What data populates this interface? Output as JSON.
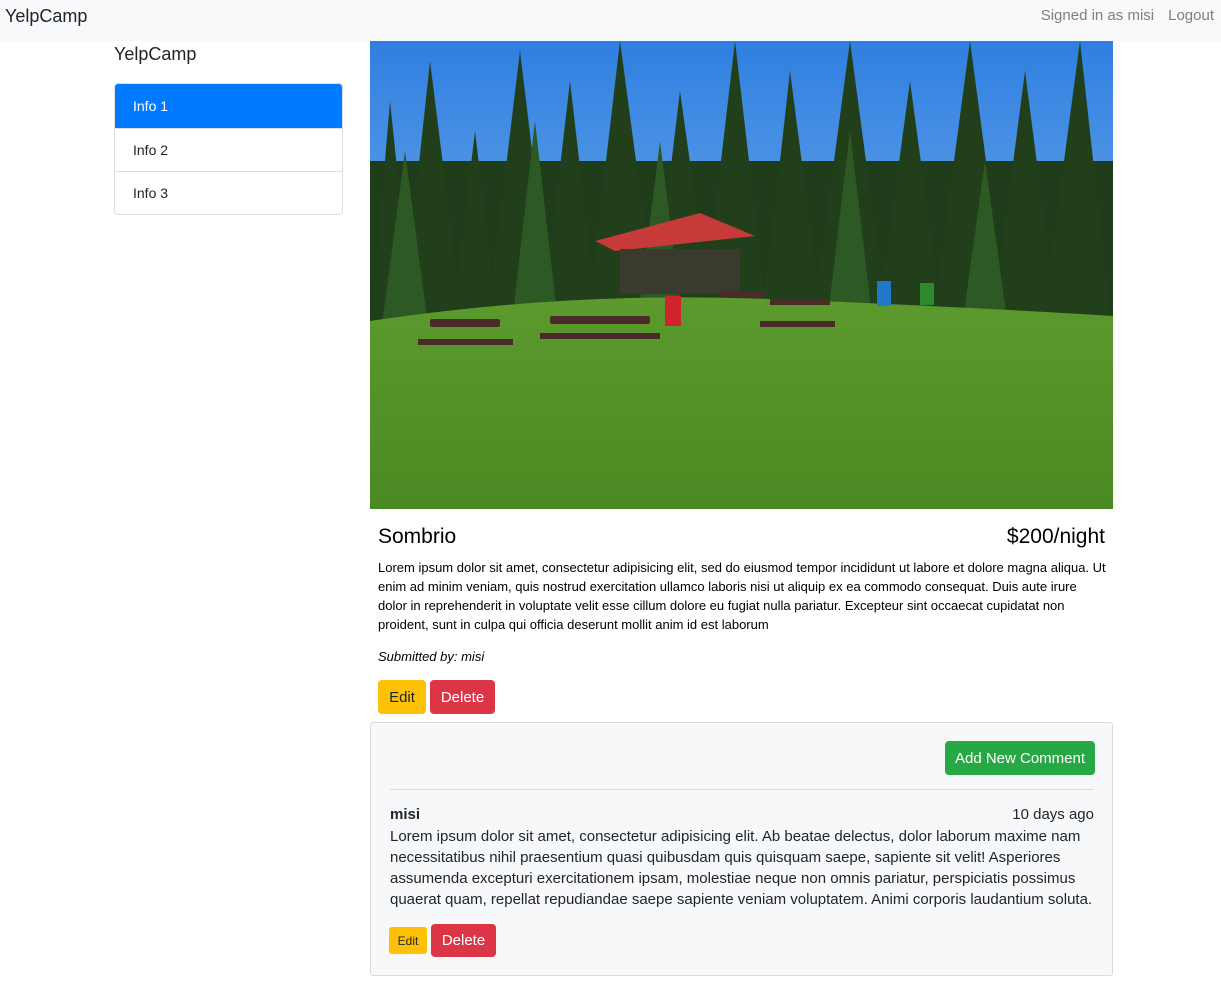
{
  "navbar": {
    "brand": "YelpCamp",
    "signed_in": "Signed in as misi",
    "logout": "Logout"
  },
  "sidebar": {
    "title": "YelpCamp",
    "items": [
      {
        "label": "Info 1",
        "active": true
      },
      {
        "label": "Info 2",
        "active": false
      },
      {
        "label": "Info 3",
        "active": false
      }
    ]
  },
  "campground": {
    "name": "Sombrio",
    "price": "$200/night",
    "description": "Lorem ipsum dolor sit amet, consectetur adipisicing elit, sed do eiusmod tempor incididunt ut labore et dolore magna aliqua. Ut enim ad minim veniam, quis nostrud exercitation ullamco laboris nisi ut aliquip ex ea commodo consequat. Duis aute irure dolor in reprehenderit in voluptate velit esse cillum dolore eu fugiat nulla pariatur. Excepteur sint occaecat cupidatat non proident, sunt in culpa qui officia deserunt mollit anim id est laborum",
    "submitted_by": "Submitted by: misi",
    "edit_label": "Edit",
    "delete_label": "Delete"
  },
  "comments": {
    "add_label": "Add New Comment",
    "items": [
      {
        "author": "misi",
        "time": "10 days ago",
        "text": "Lorem ipsum dolor sit amet, consectetur adipisicing elit. Ab beatae delectus, dolor laborum maxime nam necessitatibus nihil praesentium quasi quibusdam quis quisquam saepe, sapiente sit velit! Asperiores assumenda excepturi exercitationem ipsam, molestiae neque non omnis pariatur, perspiciatis possimus quaerat quam, repellat repudiandae saepe sapiente veniam voluptatem. Animi corporis laudantium soluta.",
        "edit_label": "Edit",
        "delete_label": "Delete"
      }
    ]
  },
  "colors": {
    "primary": "#007bff",
    "warning": "#ffc107",
    "danger": "#dc3545",
    "success": "#28a745"
  }
}
